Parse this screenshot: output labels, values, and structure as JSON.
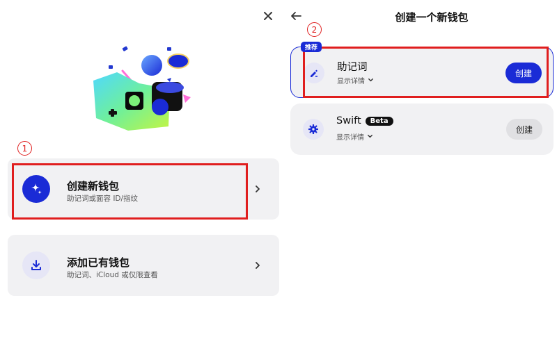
{
  "left_panel": {
    "step": "1",
    "options": [
      {
        "title": "创建新钱包",
        "subtitle": "助记词或面容 ID/指纹",
        "icon": "sparkle-icon",
        "icon_color": "#1a2bd6"
      },
      {
        "title": "添加已有钱包",
        "subtitle": "助记词、iCloud 或仅限查看",
        "icon": "download-icon",
        "icon_color": "#1a2bd6"
      }
    ]
  },
  "right_panel": {
    "title": "创建一个新钱包",
    "step": "2",
    "recommended_label": "推荐",
    "methods": [
      {
        "title": "助记词",
        "details_label": "显示详情",
        "button_label": "创建",
        "icon": "pen-icon",
        "badge": ""
      },
      {
        "title": "Swift",
        "details_label": "显示详情",
        "button_label": "创建",
        "icon": "gear-icon",
        "badge": "Beta"
      }
    ]
  },
  "colors": {
    "accent": "#1a2bd6",
    "highlight_red": "#e01e1e"
  }
}
